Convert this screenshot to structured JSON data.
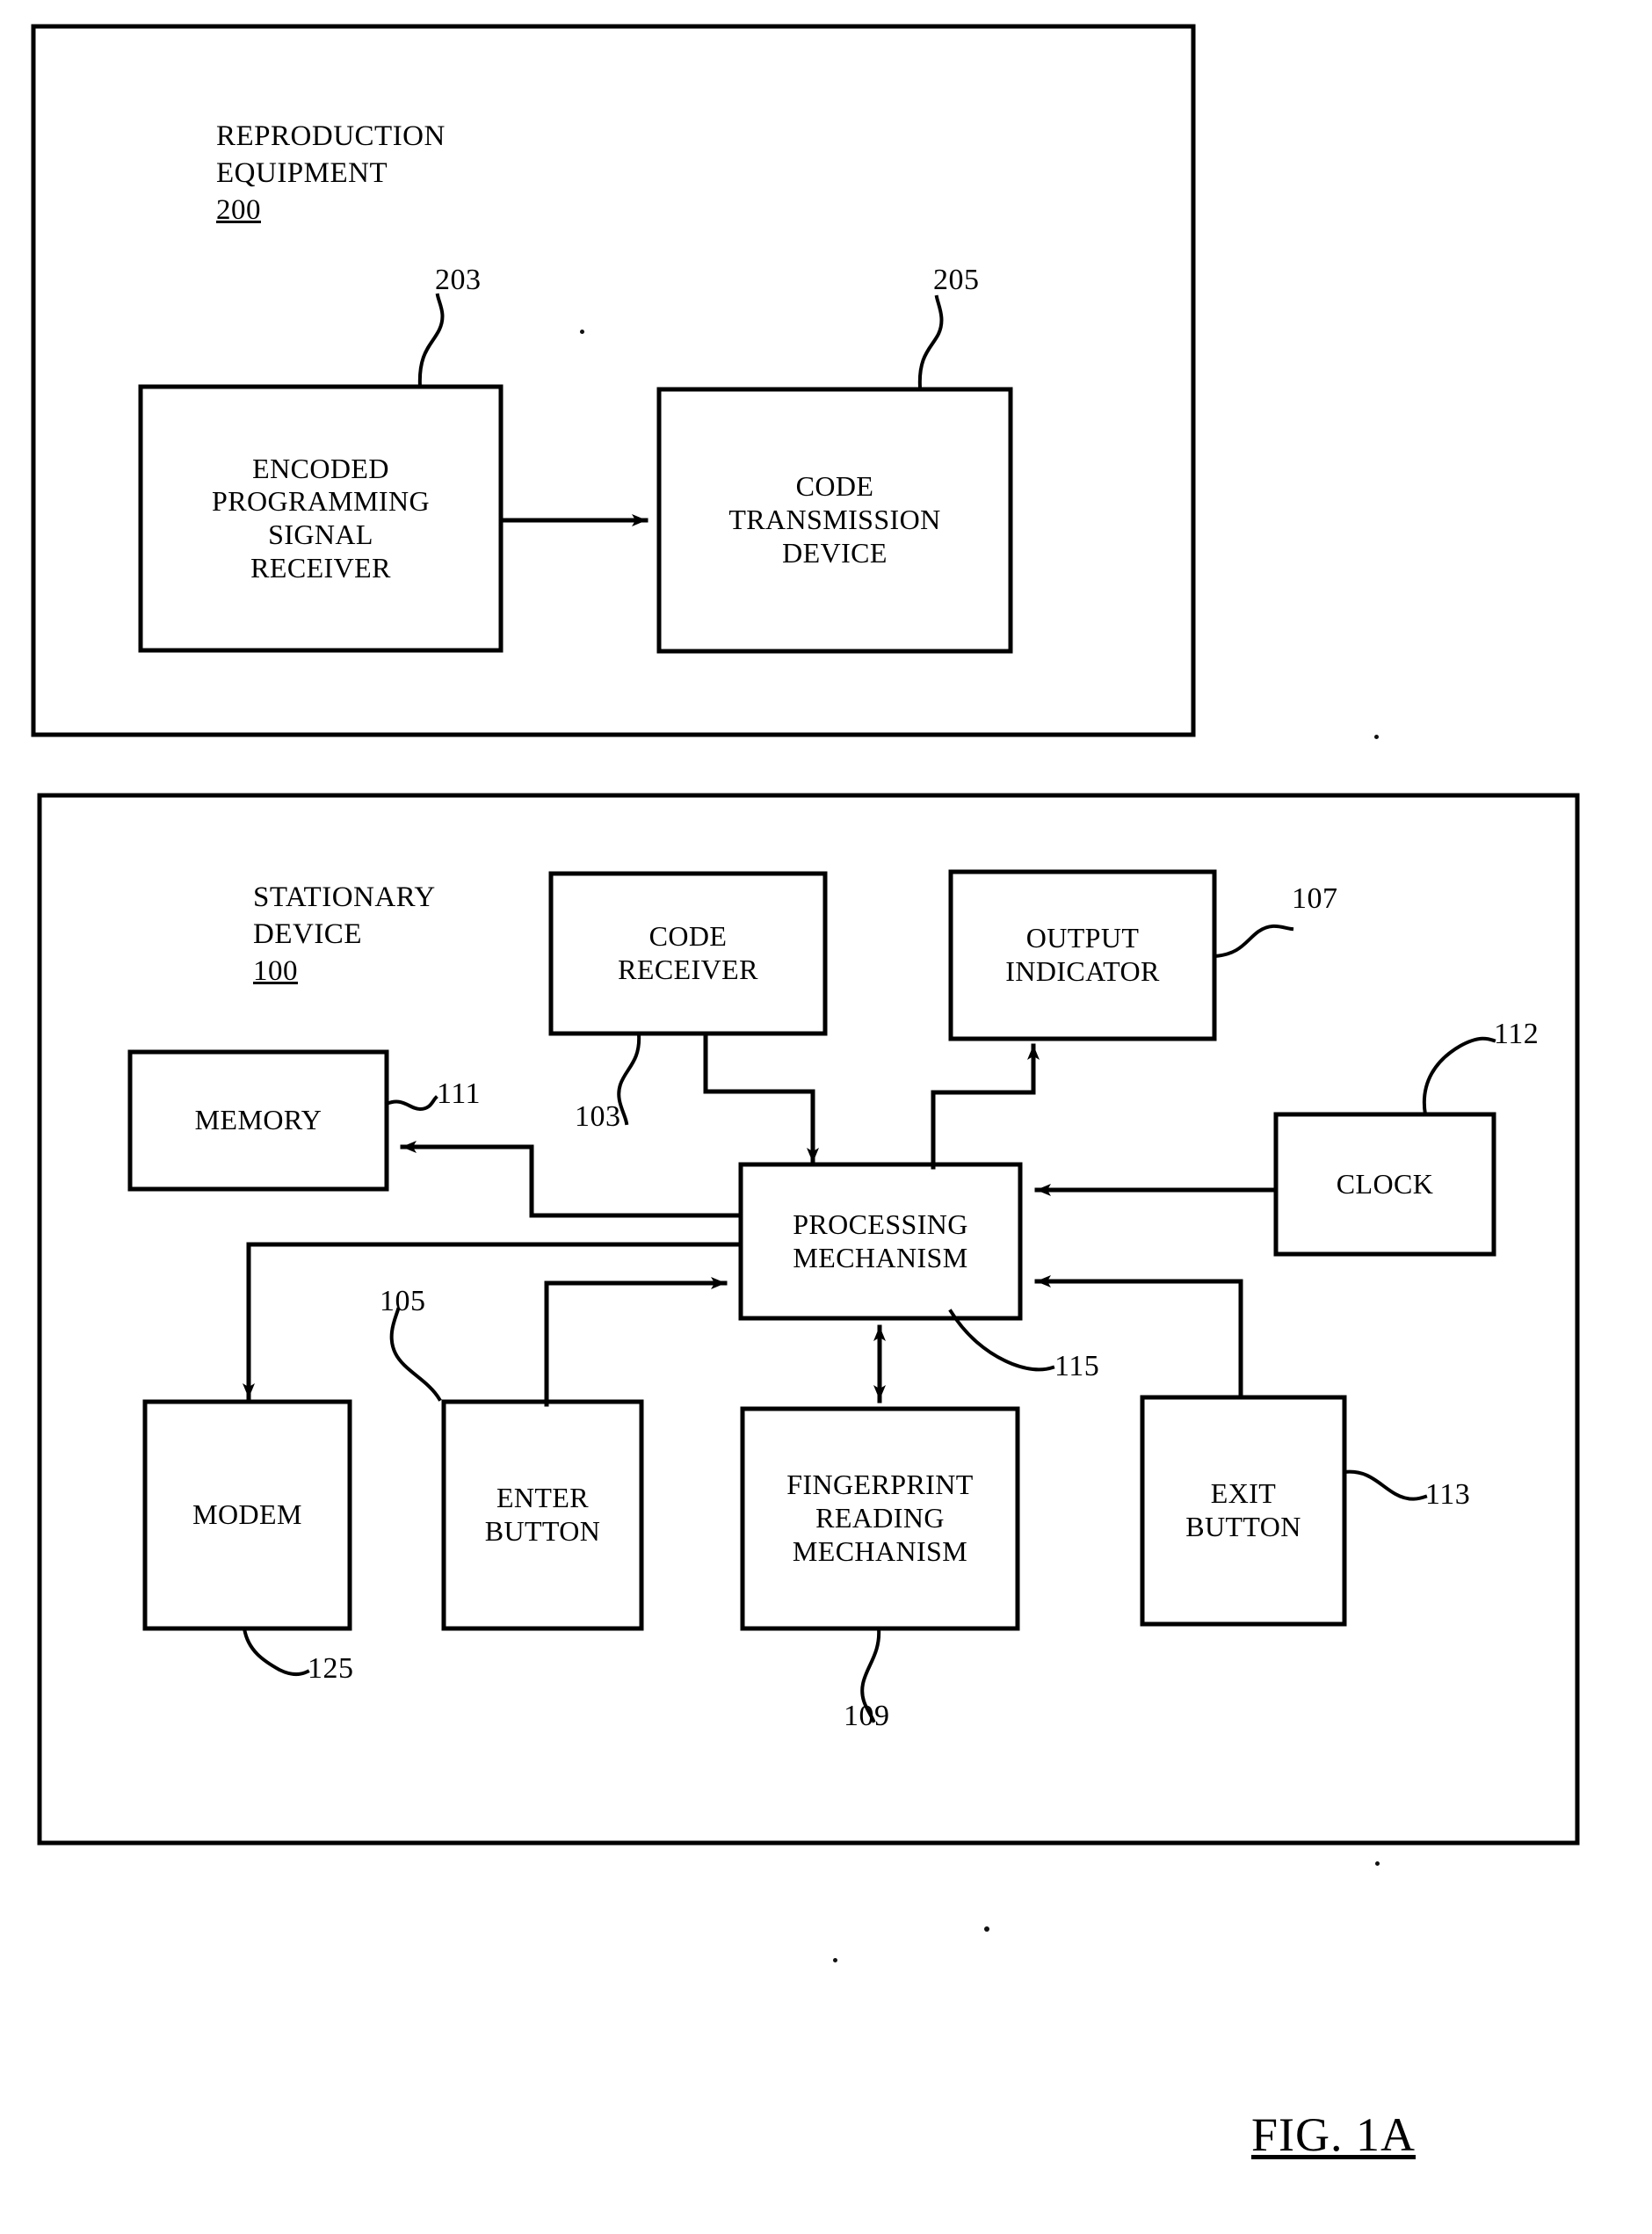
{
  "figure": {
    "caption": "FIG. 1A",
    "type": "patent-block-diagram"
  },
  "groups": [
    {
      "id": "reproduction-equipment",
      "title_line1": "REPRODUCTION",
      "title_line2": "EQUIPMENT",
      "ref": "200"
    },
    {
      "id": "stationary-device",
      "title_line1": "STATIONARY",
      "title_line2": "DEVICE",
      "ref": "100"
    }
  ],
  "blocks": {
    "encoded_programming_signal_receiver": "ENCODED\nPROGRAMMING\nSIGNAL\nRECEIVER",
    "code_transmission_device": "CODE\nTRANSMISSION\nDEVICE",
    "code_receiver": "CODE\nRECEIVER",
    "output_indicator": "OUTPUT\nINDICATOR",
    "memory": "MEMORY",
    "clock": "CLOCK",
    "processing_mechanism": "PROCESSING\nMECHANISM",
    "modem": "MODEM",
    "enter_button": "ENTER\nBUTTON",
    "fingerprint_reading_mechanism": "FINGERPRINT\nREADING\nMECHANISM",
    "exit_button": "EXIT\nBUTTON"
  },
  "ref_numbers": {
    "encoded_programming_signal_receiver": "203",
    "code_transmission_device": "205",
    "code_receiver": "103",
    "output_indicator": "107",
    "memory": "111",
    "clock": "112",
    "processing_mechanism": "115",
    "modem": "125",
    "enter_button": "105",
    "fingerprint_reading_mechanism": "109",
    "exit_button": "113"
  },
  "connections": [
    {
      "from": "encoded_programming_signal_receiver",
      "to": "code_transmission_device",
      "style": "arrow-right"
    },
    {
      "from": "code_receiver",
      "to": "processing_mechanism",
      "style": "arrow-down"
    },
    {
      "from": "processing_mechanism",
      "to": "output_indicator",
      "style": "arrow-up"
    },
    {
      "from": "processing_mechanism",
      "to": "memory",
      "style": "arrow-left"
    },
    {
      "from": "clock",
      "to": "processing_mechanism",
      "style": "arrow-left"
    },
    {
      "from": "processing_mechanism",
      "to": "modem",
      "style": "arrow-down"
    },
    {
      "from": "enter_button",
      "to": "processing_mechanism",
      "style": "arrow-right"
    },
    {
      "from": "processing_mechanism",
      "to": "fingerprint_reading_mechanism",
      "style": "arrow-bidirectional"
    },
    {
      "from": "exit_button",
      "to": "processing_mechanism",
      "style": "arrow-left"
    }
  ],
  "colors": {
    "ink": "#000000",
    "paper": "#ffffff"
  }
}
